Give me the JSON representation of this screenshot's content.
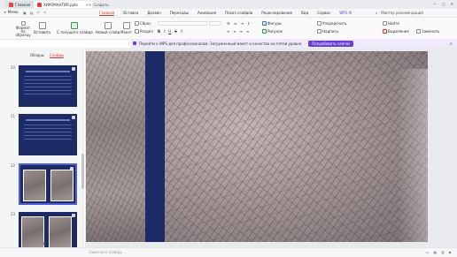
{
  "titlebar": {
    "home_tab": "Главная",
    "doc_tab": "ХИРОМАНТИЯ.pptx",
    "new_tab": "Создать",
    "window_controls": [
      "—",
      "▢",
      "✕"
    ]
  },
  "menubar": {
    "menu_label": "Меню",
    "items": [
      "Главная",
      "Вставка",
      "Дизайн",
      "Переходы",
      "Анимация",
      "Показ слайдов",
      "Рецензирование",
      "Вид",
      "Сервис"
    ],
    "ai_label": "WPS AI",
    "right_label": "Мастер рекомендаций",
    "active_color": "#d13b2e"
  },
  "toolbar": {
    "format_painter": "Формат по образцу",
    "insert": "Вставить",
    "start_slideshow": "С текущего слайда",
    "new_slide": "Новый слайд",
    "layout": "Макет",
    "reset": "Сброс",
    "section": "Раздел",
    "shapes": "Фигуры",
    "picture": "Рисунок",
    "arrange": "Упорядочить",
    "find": "Найти",
    "select": "Выделение",
    "text_box": "Надпись",
    "replace": "Заменить"
  },
  "banner": {
    "text": "Перейти к WPS для профессионалов. Загруженный макет и качество на пятой уровне",
    "button_label": "Попробовать сейчас",
    "close": "✕",
    "accent": "#6a3fd3"
  },
  "sidebar": {
    "tabs": [
      "Обзоры",
      "Слайды"
    ],
    "active_tab": "Слайды",
    "slides": [
      {
        "number": "20"
      },
      {
        "number": "21"
      },
      {
        "number": "22",
        "selected": true
      },
      {
        "number": "23"
      }
    ],
    "add_slide_label": "+"
  },
  "status": {
    "notes_placeholder": "Заметки к слайду"
  },
  "colors": {
    "slide_background": "#1c2a66",
    "selection": "#4d5fd0"
  }
}
